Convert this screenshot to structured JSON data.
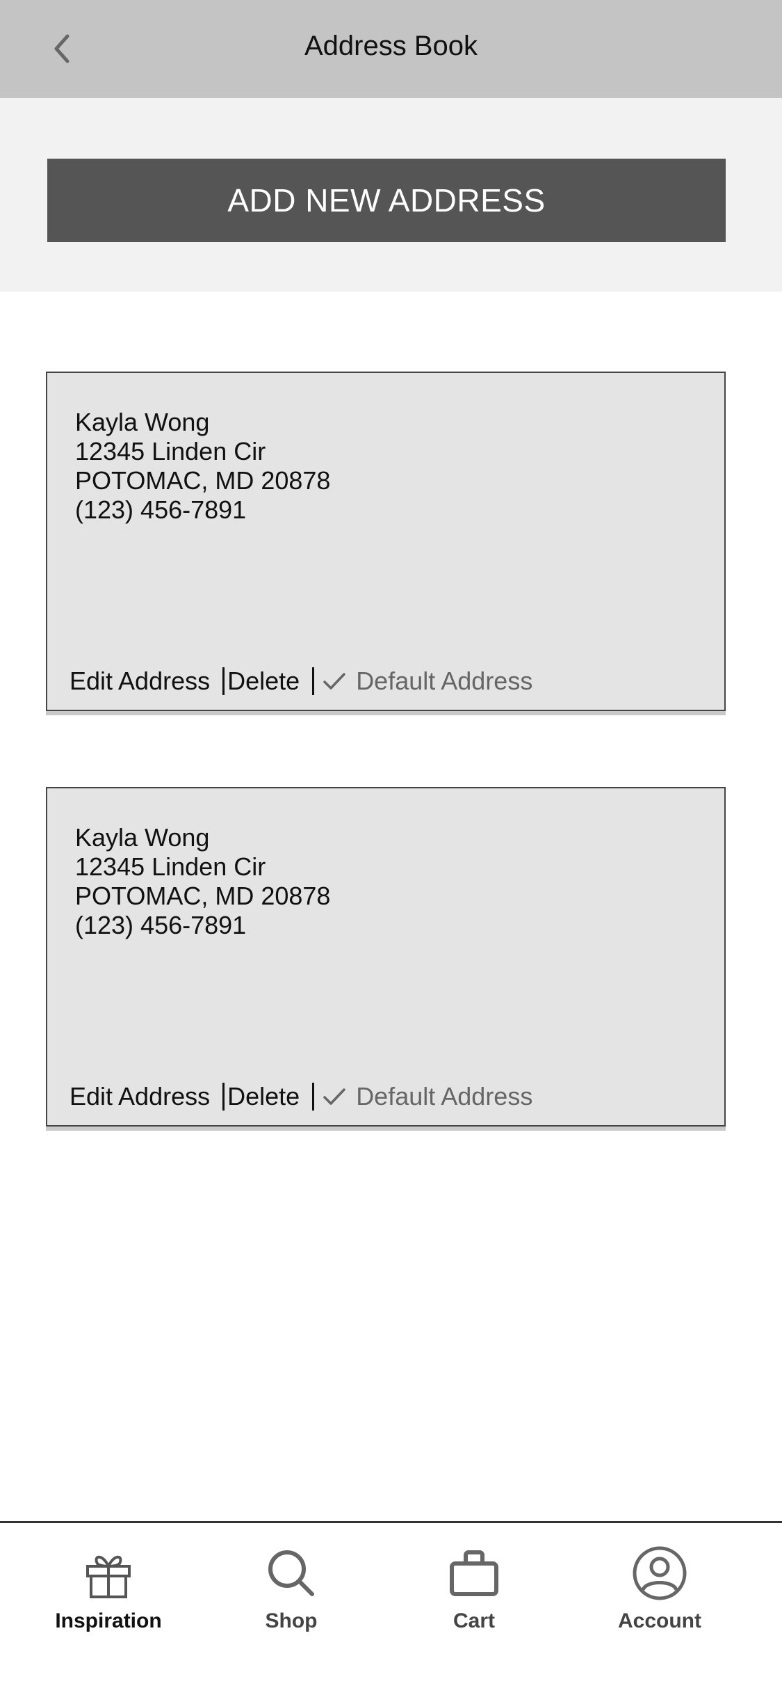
{
  "header": {
    "title": "Address Book",
    "back_icon": "chevron-left-icon"
  },
  "add_button": {
    "label": "ADD NEW ADDRESS"
  },
  "addresses": [
    {
      "name": "Kayla Wong",
      "street": "12345 Linden Cir",
      "city_state_zip": "POTOMAC, MD 20878",
      "phone": "(123) 456-7891",
      "edit_label": "Edit Address",
      "delete_label": "Delete",
      "default_label": "Default Address"
    },
    {
      "name": "Kayla Wong",
      "street": "12345 Linden Cir",
      "city_state_zip": "POTOMAC, MD 20878",
      "phone": "(123) 456-7891",
      "edit_label": "Edit Address",
      "delete_label": "Delete",
      "default_label": "Default Address"
    }
  ],
  "tabbar": {
    "items": [
      {
        "label": "Inspiration",
        "icon": "gift-icon",
        "active": true
      },
      {
        "label": "Shop",
        "icon": "search-icon"
      },
      {
        "label": "Cart",
        "icon": "briefcase-icon"
      },
      {
        "label": "Account",
        "icon": "user-circle-icon"
      }
    ]
  },
  "colors": {
    "header_bg": "#c4c4c4",
    "section_bg": "#f2f2f2",
    "button_bg": "#555555",
    "card_bg": "#e4e4e4",
    "muted_text": "#666666"
  }
}
